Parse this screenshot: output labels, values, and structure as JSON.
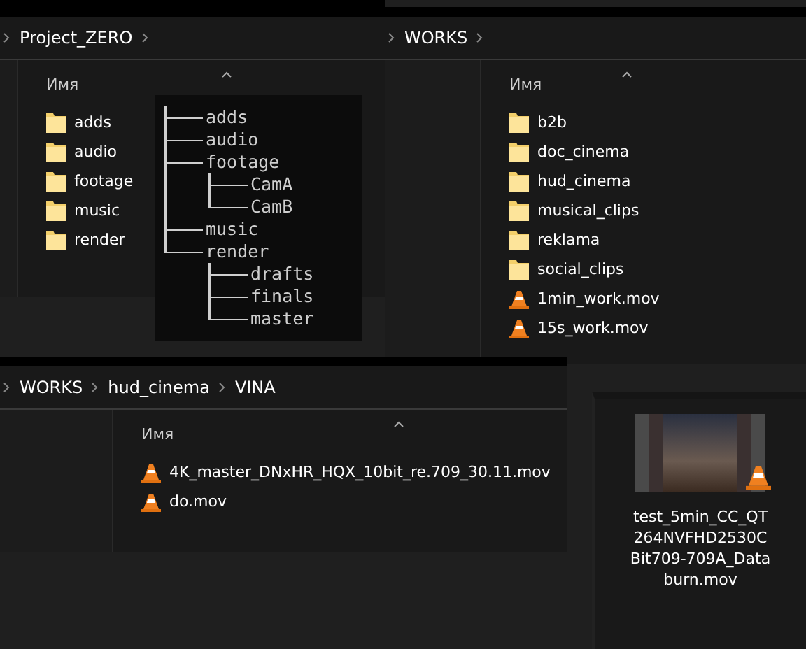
{
  "windows": [
    {
      "breadcrumb": [
        "Project_ZERO"
      ],
      "trailing_chevron": true,
      "column_header": "Имя",
      "items": [
        {
          "name": "adds",
          "kind": "folder"
        },
        {
          "name": "audio",
          "kind": "folder"
        },
        {
          "name": "footage",
          "kind": "folder"
        },
        {
          "name": "music",
          "kind": "folder"
        },
        {
          "name": "render",
          "kind": "folder"
        }
      ]
    },
    {
      "breadcrumb": [
        "WORKS"
      ],
      "trailing_chevron": true,
      "column_header": "Имя",
      "items": [
        {
          "name": "b2b",
          "kind": "folder"
        },
        {
          "name": "doc_cinema",
          "kind": "folder"
        },
        {
          "name": "hud_cinema",
          "kind": "folder"
        },
        {
          "name": "musical_clips",
          "kind": "folder"
        },
        {
          "name": "reklama",
          "kind": "folder"
        },
        {
          "name": "social_clips",
          "kind": "folder"
        },
        {
          "name": "1min_work.mov",
          "kind": "video"
        },
        {
          "name": "15s_work.mov",
          "kind": "video"
        }
      ]
    },
    {
      "breadcrumb": [
        "WORKS",
        "hud_cinema",
        "VINA"
      ],
      "trailing_chevron": false,
      "column_header": "Имя",
      "items": [
        {
          "name": "4K_master_DNxHR_HQX_10bit_re.709_30.11.mov",
          "kind": "video"
        },
        {
          "name": "do.mov",
          "kind": "video"
        }
      ]
    }
  ],
  "terminal_tree": [
    {
      "name": "adds"
    },
    {
      "name": "audio"
    },
    {
      "name": "footage",
      "children": [
        {
          "name": "CamA"
        },
        {
          "name": "CamB"
        }
      ]
    },
    {
      "name": "music"
    },
    {
      "name": "render",
      "children": [
        {
          "name": "drafts"
        },
        {
          "name": "finals"
        },
        {
          "name": "master"
        }
      ]
    }
  ],
  "thumbnail_tile": {
    "name_lines": [
      "test_5min_CC_QT",
      "264NVFHD2530C",
      "Bit709-709A_Data",
      "burn.mov"
    ]
  }
}
